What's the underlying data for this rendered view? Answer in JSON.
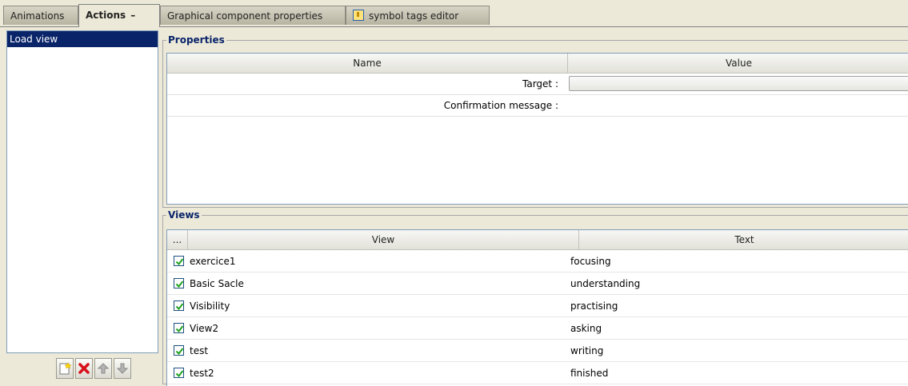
{
  "tabs": [
    {
      "label": "Animations"
    },
    {
      "label": "Actions",
      "close": "–"
    },
    {
      "label": "Graphical component properties"
    },
    {
      "label": "symbol tags editor",
      "icon": "tag-icon"
    }
  ],
  "actions_list": {
    "items": [
      "Load view"
    ]
  },
  "buttons": {
    "icons": [
      "new-action-icon",
      "delete-icon",
      "move-up-icon",
      "move-down-icon"
    ]
  },
  "properties": {
    "title": "Properties",
    "col_name": "Name",
    "col_value": "Value",
    "rows": [
      {
        "label": "Target :",
        "value": ""
      },
      {
        "label": "Confirmation message :",
        "value": ""
      }
    ]
  },
  "views": {
    "title": "Views",
    "col_menu": "...",
    "col_view": "View",
    "col_text": "Text",
    "rows": [
      {
        "checked": true,
        "view": "exercice1",
        "text": "focusing"
      },
      {
        "checked": true,
        "view": "Basic Sacle",
        "text": "understanding"
      },
      {
        "checked": true,
        "view": "Visibility",
        "text": "practising"
      },
      {
        "checked": true,
        "view": "View2",
        "text": "asking"
      },
      {
        "checked": true,
        "view": "test",
        "text": "writing"
      },
      {
        "checked": true,
        "view": "test2",
        "text": "finished"
      }
    ]
  },
  "colors": {
    "selection": "#0a246a",
    "group_title": "#0a246a",
    "window_bg": "#ece9d8"
  }
}
